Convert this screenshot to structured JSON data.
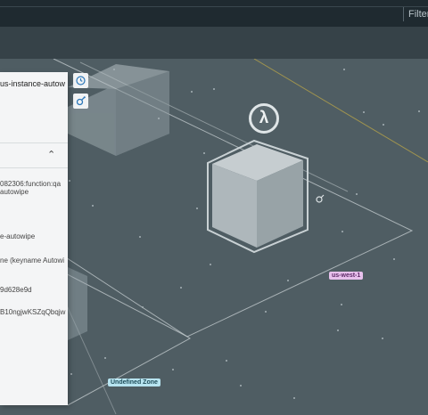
{
  "topbar": {
    "filters_label": "Filters"
  },
  "panel": {
    "title": "us-instance-autow",
    "lines": [
      "082306:function:qa",
      "autowipe",
      "e-autowipe",
      "ne (keyname Autowi",
      "9d628e9d",
      "B10ngjwKSZqQbqjw"
    ]
  },
  "zones": {
    "region_label": "us-west-1",
    "undefined_label": "Undefined Zone"
  },
  "lambda_symbol": "λ",
  "icons": [
    "clock-icon",
    "settings-icon",
    "chevron-up-icon",
    "lambda-icon",
    "link-icon"
  ],
  "colors": {
    "background": "#4f5d63",
    "region_badge": "#e7c0ec",
    "undefined_badge": "#b7e4f0",
    "panel_bg": "#f4f5f6"
  }
}
